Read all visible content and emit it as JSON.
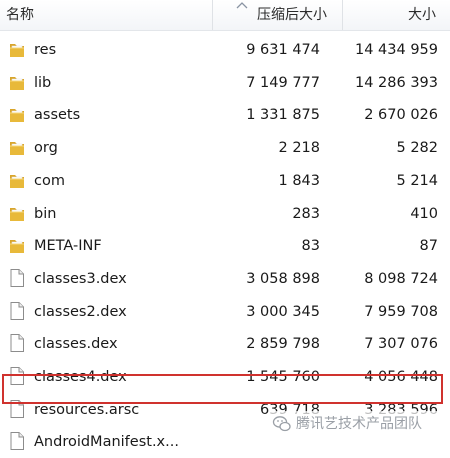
{
  "header": {
    "name": "名称",
    "compressed": "压缩后大小",
    "size": "大小"
  },
  "rows": [
    {
      "name": "res",
      "compressed": "9 631 474",
      "size": "14 434 959",
      "icon": "folder-icon"
    },
    {
      "name": "lib",
      "compressed": "7 149 777",
      "size": "14 286 393",
      "icon": "folder-icon"
    },
    {
      "name": "assets",
      "compressed": "1 331 875",
      "size": "2 670 026",
      "icon": "folder-icon"
    },
    {
      "name": "org",
      "compressed": "2 218",
      "size": "5 282",
      "icon": "folder-icon"
    },
    {
      "name": "com",
      "compressed": "1 843",
      "size": "5 214",
      "icon": "folder-icon"
    },
    {
      "name": "bin",
      "compressed": "283",
      "size": "410",
      "icon": "folder-icon"
    },
    {
      "name": "META-INF",
      "compressed": "83",
      "size": "87",
      "icon": "folder-icon"
    },
    {
      "name": "classes3.dex",
      "compressed": "3 058 898",
      "size": "8 098 724",
      "icon": "file-icon"
    },
    {
      "name": "classes2.dex",
      "compressed": "3 000 345",
      "size": "7 959 708",
      "icon": "file-icon"
    },
    {
      "name": "classes.dex",
      "compressed": "2 859 798",
      "size": "7 307 076",
      "icon": "file-icon"
    },
    {
      "name": "classes4.dex",
      "compressed": "1 545 760",
      "size": "4 056 448",
      "icon": "file-icon"
    },
    {
      "name": "resources.arsc",
      "compressed": "639 718",
      "size": "3 283 596",
      "icon": "file-icon"
    },
    {
      "name": "AndroidManifest.x...",
      "compressed": "",
      "size": "",
      "icon": "file-icon"
    }
  ],
  "watermark": {
    "text": "腾讯艺技术产品团队",
    "icon": "wechat-icon"
  },
  "colors": {
    "highlight": "#d0322e",
    "folder": "#e8b93a",
    "header_bg": "#f3f5f8"
  }
}
